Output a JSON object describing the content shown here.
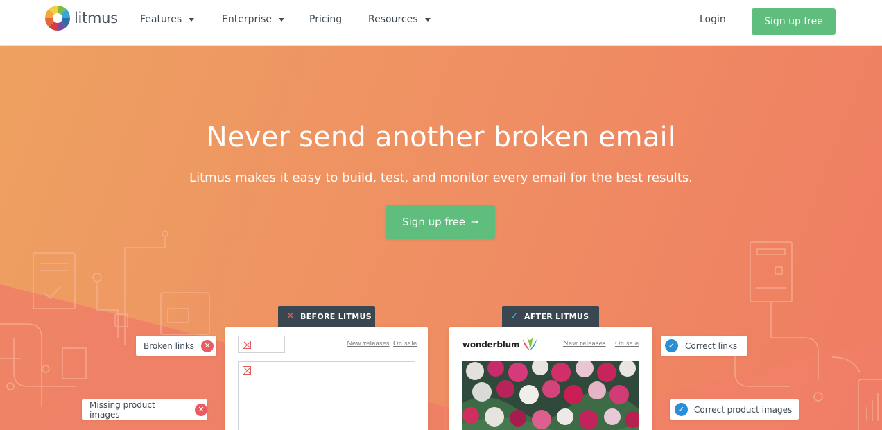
{
  "brand": {
    "name": "litmus"
  },
  "nav": {
    "items": [
      {
        "label": "Features",
        "dropdown": true
      },
      {
        "label": "Enterprise",
        "dropdown": true
      },
      {
        "label": "Pricing",
        "dropdown": false
      },
      {
        "label": "Resources",
        "dropdown": true
      }
    ],
    "login": "Login",
    "signup": "Sign up free"
  },
  "hero": {
    "title": "Never send another broken email",
    "subtitle": "Litmus makes it easy to build, test, and monitor every email for the best results.",
    "cta": "Sign up free"
  },
  "before": {
    "tag": "BEFORE LITMUS",
    "links": [
      "New releases",
      "On sale"
    ],
    "callouts": [
      "Broken links",
      "Missing product images"
    ]
  },
  "after": {
    "tag": "AFTER LITMUS",
    "brand": "wonderblum",
    "links": [
      "New releases",
      "On sale"
    ],
    "callouts": [
      "Correct links",
      "Correct product images"
    ]
  },
  "colors": {
    "accent_green": "#5fbd7d",
    "hero_orange": "#ef8d63",
    "tag_dark": "#3a4750",
    "error_red": "#ea5b62",
    "check_blue": "#2b8fd6"
  },
  "icons": {
    "arrow": "arrow-right-icon",
    "x": "close-icon",
    "check": "check-icon"
  }
}
